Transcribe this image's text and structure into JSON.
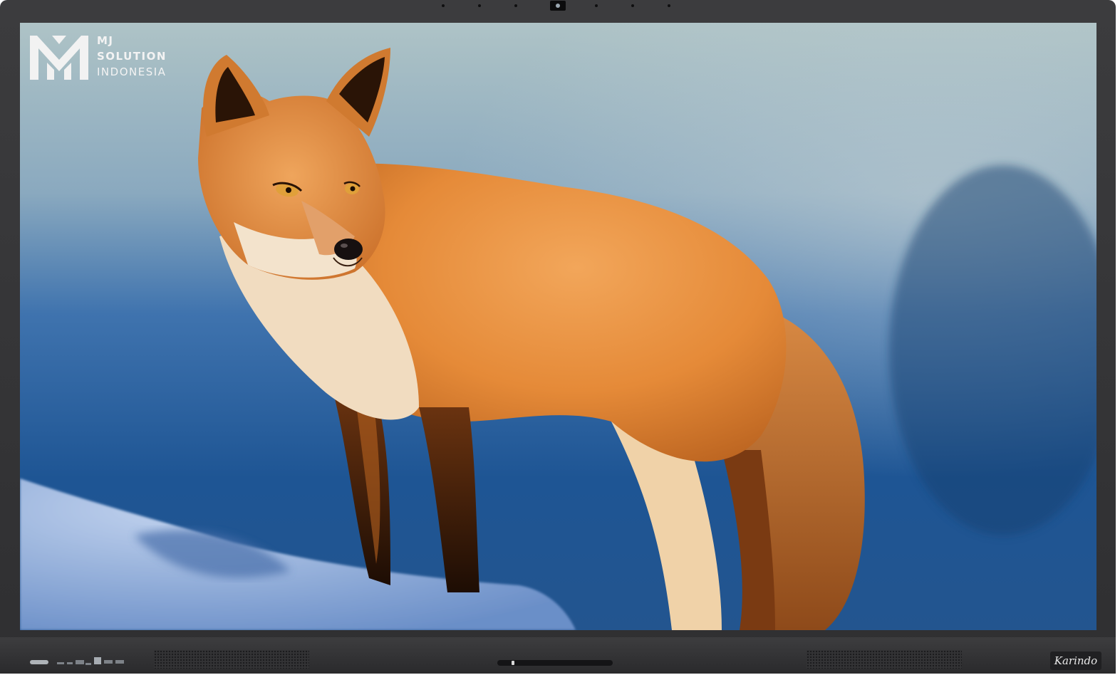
{
  "logo": {
    "line1": "MJ",
    "line2": "SOLUTION",
    "line3": "INDONESIA"
  },
  "brand": "Karindo",
  "colors": {
    "bezel": "#3a3a3c",
    "sky_top": "#a9c0c4",
    "sky_mid": "#3f78b6",
    "background_blue": "#1b4e86",
    "snow": "#9fb8df",
    "fox_orange": "#e58a38",
    "fox_cream": "#f1dcc0",
    "fox_dark": "#2a1406"
  },
  "icons": {
    "camera": "camera-icon",
    "logo": "mj-logo-icon",
    "power": "power-button-icon"
  },
  "image_subject": "red fox standing on snow"
}
